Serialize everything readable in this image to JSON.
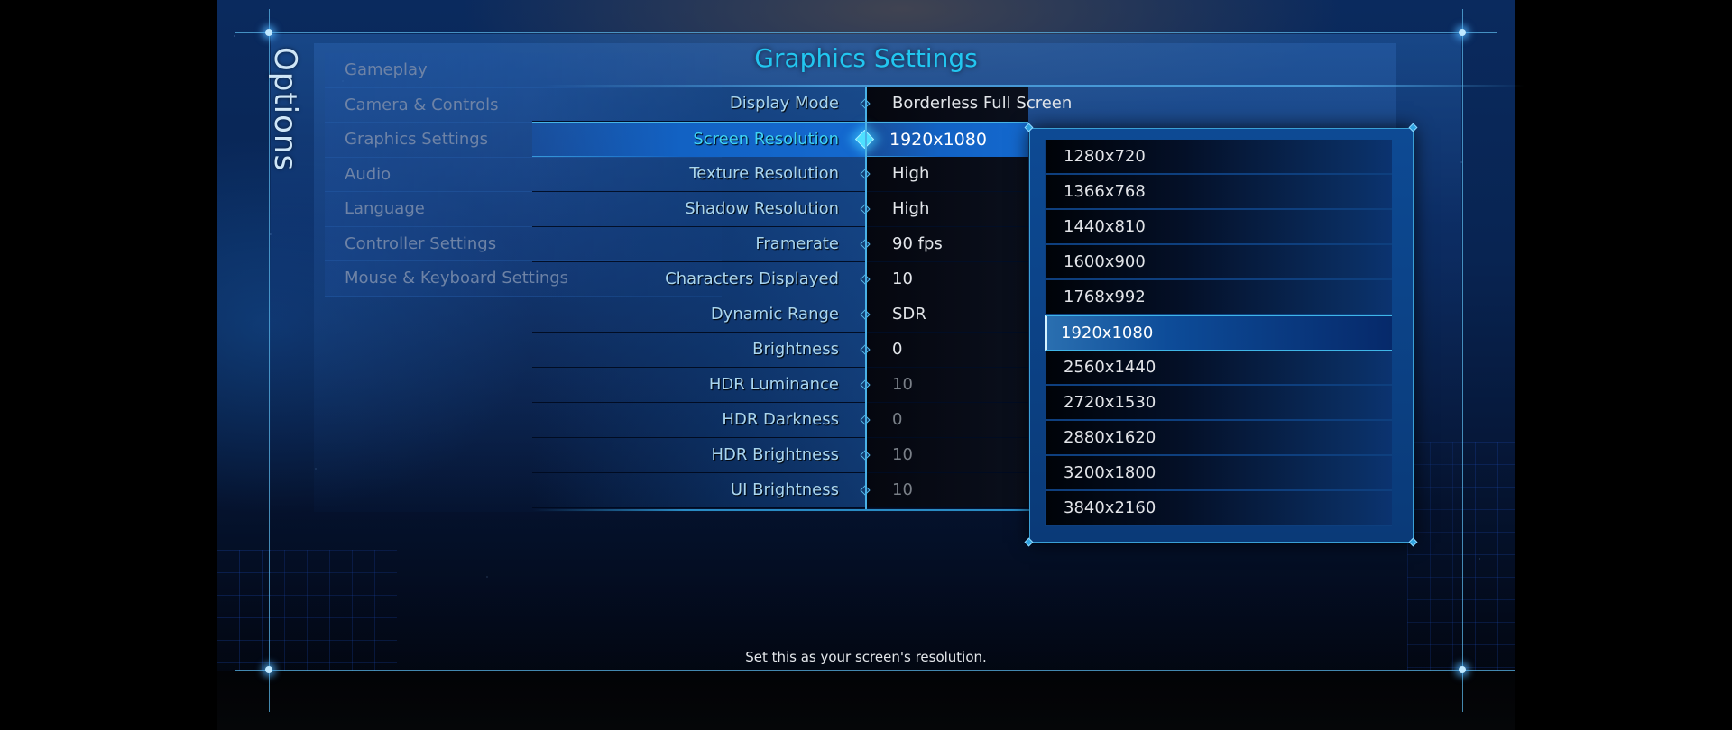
{
  "screen": {
    "side_title": "Options",
    "section_title": "Graphics Settings",
    "hint": "Set this as your screen's resolution."
  },
  "nav": {
    "items": [
      {
        "label": "Gameplay"
      },
      {
        "label": "Camera & Controls"
      },
      {
        "label": "Graphics Settings"
      },
      {
        "label": "Audio"
      },
      {
        "label": "Language"
      },
      {
        "label": "Controller Settings"
      },
      {
        "label": "Mouse & Keyboard Settings"
      }
    ]
  },
  "settings": {
    "selected_index": 1,
    "rows": [
      {
        "label": "Display Mode",
        "value": "Borderless Full Screen",
        "enabled": true
      },
      {
        "label": "Screen Resolution",
        "value": "1920x1080",
        "enabled": true
      },
      {
        "label": "Texture Resolution",
        "value": "High",
        "enabled": true
      },
      {
        "label": "Shadow Resolution",
        "value": "High",
        "enabled": true
      },
      {
        "label": "Framerate",
        "value": "90 fps",
        "enabled": true
      },
      {
        "label": "Characters Displayed",
        "value": "10",
        "enabled": true
      },
      {
        "label": "Dynamic Range",
        "value": "SDR",
        "enabled": true
      },
      {
        "label": "Brightness",
        "value": "0",
        "enabled": true
      },
      {
        "label": "HDR Luminance",
        "value": "10",
        "enabled": false
      },
      {
        "label": "HDR Darkness",
        "value": "0",
        "enabled": false
      },
      {
        "label": "HDR Brightness",
        "value": "10",
        "enabled": false
      },
      {
        "label": "UI Brightness",
        "value": "10",
        "enabled": false
      }
    ]
  },
  "resolution_dropdown": {
    "selected": "1920x1080",
    "options": [
      "1280x720",
      "1366x768",
      "1440x810",
      "1600x900",
      "1768x992",
      "1920x1080",
      "2560x1440",
      "2720x1530",
      "2880x1620",
      "3200x1800",
      "3840x2160"
    ]
  },
  "colors": {
    "accent_cyan": "#22c6f0",
    "selected_row_blue": "#1469cf",
    "label_text": "#a9d6f0",
    "nav_inactive": "#6e83a6"
  }
}
